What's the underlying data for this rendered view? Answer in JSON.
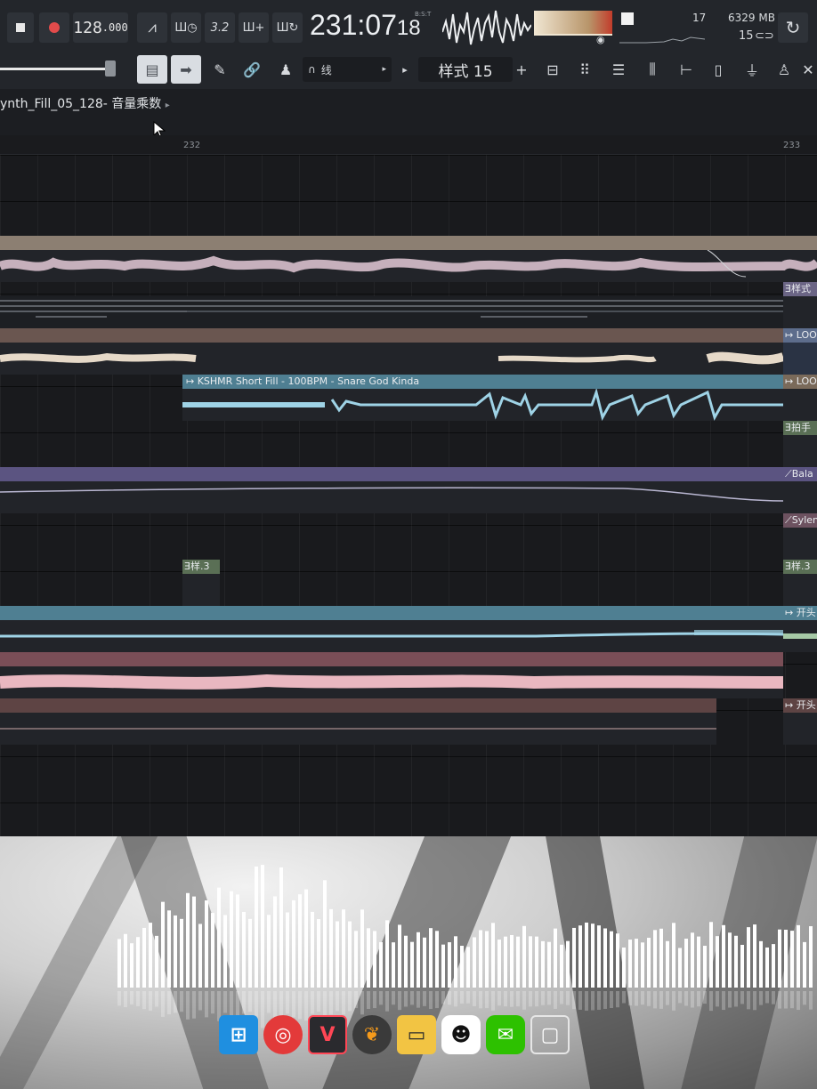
{
  "transport": {
    "tempo_int": "128",
    "tempo_dec": ".000",
    "time_main": "231:07",
    "time_ms": "18",
    "time_format": "B:S:T",
    "snap_label": "3.2",
    "cpu_count": "17",
    "memory": "6329 MB",
    "voices": "15"
  },
  "toolbar": {
    "snap_mode": "线",
    "pattern_name": "样式 15",
    "plus": "+"
  },
  "breadcrumb": {
    "text": "ynth_Fill_05_128- 音量乘数",
    "arrow": "▸"
  },
  "ruler": {
    "bar_232": "232",
    "bar_233": "233"
  },
  "clips": {
    "pattern_right_1": "样式",
    "loop_right_1": "LOOP",
    "kshmr_label": "KSHMR Short Fill - 100BPM - Snare God Kinda",
    "loop_right_2": "LOOP",
    "clap_right": "拍手",
    "balance_right": "Bala",
    "sylen_right": "Sylen",
    "pattern_small": "样.3",
    "pattern_small_right": "样.3",
    "intro_right_1": "开头",
    "intro_right_2": "开头"
  },
  "colors": {
    "wave_pink": "#e3c9d6",
    "wave_cream": "#e6d9c8",
    "wave_blue": "#9fd3e6",
    "wave_rose": "#e9b7c0",
    "clip_tan": "#8c7f72",
    "clip_brown": "#6a5650",
    "clip_teal": "#4f7f92",
    "clip_purple": "#5b5481",
    "clip_rose": "#7a4e57",
    "clip_darkred": "#5e4444"
  },
  "dock": {
    "apps": [
      "windows-icon",
      "netease-music-icon",
      "valorant-icon",
      "fl-studio-icon",
      "file-explorer-icon",
      "qq-icon",
      "wechat-icon",
      "task-view-icon"
    ]
  }
}
